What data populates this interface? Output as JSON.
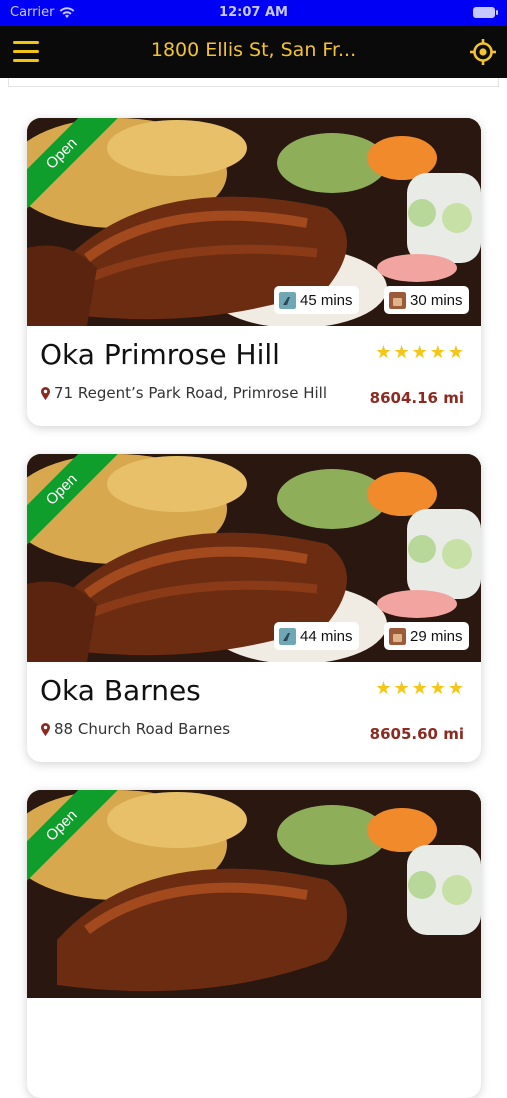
{
  "status_bar": {
    "carrier": "Carrier",
    "time": "12:07 AM"
  },
  "nav": {
    "title": "1800 Ellis St, San Fr..."
  },
  "restaurants": [
    {
      "status": "Open",
      "walk_time": "45 mins",
      "drive_time": "30 mins",
      "name": "Oka Primrose Hill",
      "rating": "★★★★★",
      "address": "71 Regent’s Park Road, Primrose Hill",
      "distance": "8604.16 mi"
    },
    {
      "status": "Open",
      "walk_time": "44 mins",
      "drive_time": "29 mins",
      "name": "Oka Barnes",
      "rating": "★★★★★",
      "address": "88 Church Road Barnes",
      "distance": "8605.60 mi"
    },
    {
      "status": "Open",
      "walk_time": "",
      "drive_time": "",
      "name": "",
      "rating": "",
      "address": "",
      "distance": ""
    }
  ],
  "colors": {
    "status_bar": "#0000f5",
    "nav_bar": "#0a0a0a",
    "accent": "#f1c232",
    "open_ribbon": "#0f9d2b",
    "distance": "#8b2a1f",
    "stars": "#f5c518"
  },
  "icons": {
    "menu": "hamburger-icon",
    "locate": "crosshair-icon",
    "walk": "walk-icon",
    "drive": "drive-icon",
    "pin": "location-pin-icon"
  }
}
